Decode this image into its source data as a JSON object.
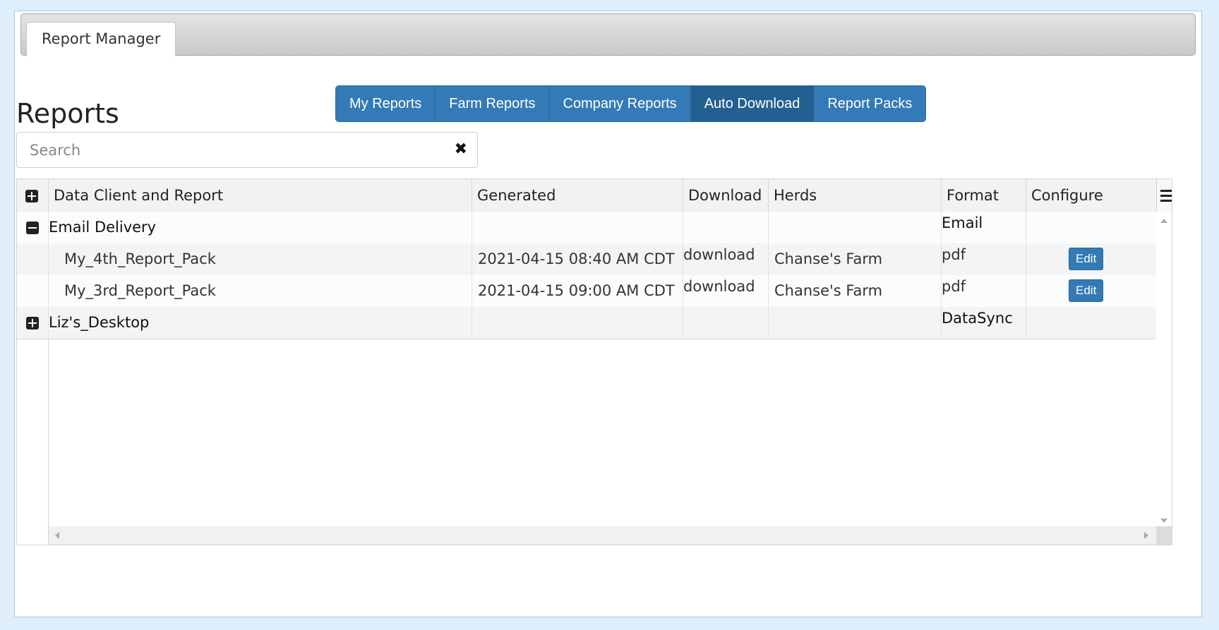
{
  "tab": {
    "label": "Report Manager"
  },
  "page_title": "Reports",
  "nav": {
    "buttons": [
      {
        "label": "My Reports",
        "active": false
      },
      {
        "label": "Farm Reports",
        "active": false
      },
      {
        "label": "Company Reports",
        "active": false
      },
      {
        "label": "Auto Download",
        "active": true
      },
      {
        "label": "Report Packs",
        "active": false
      }
    ]
  },
  "search": {
    "placeholder": "Search",
    "value": ""
  },
  "table": {
    "headers": [
      "Data Client and Report",
      "Generated",
      "Download",
      "Herds",
      "Format",
      "Configure"
    ],
    "groups": [
      {
        "name": "Email Delivery",
        "format": "Email",
        "expanded": true,
        "rows": [
          {
            "report": "My_4th_Report_Pack",
            "generated": "2021-04-15 08:40 AM CDT",
            "download": "download",
            "herds": "Chanse's Farm",
            "format": "pdf",
            "configure": "Edit"
          },
          {
            "report": "My_3rd_Report_Pack",
            "generated": "2021-04-15 09:00 AM CDT",
            "download": "download",
            "herds": "Chanse's Farm",
            "format": "pdf",
            "configure": "Edit"
          }
        ]
      },
      {
        "name": "Liz's_Desktop",
        "format": "DataSync",
        "expanded": false,
        "rows": []
      }
    ]
  },
  "colors": {
    "primary": "#337ab7",
    "active": "#245f91",
    "background": "#deeefb"
  }
}
